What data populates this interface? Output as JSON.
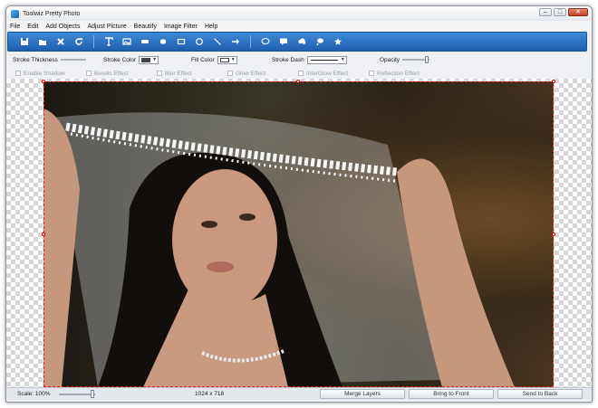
{
  "window": {
    "title": "Toolwiz Pretty Photo"
  },
  "menu": [
    "File",
    "Edit",
    "Add Objects",
    "Adjust Picture",
    "Beautify",
    "Image Filter",
    "Help"
  ],
  "toolbar": {
    "groups": [
      [
        "save-icon",
        "open-folder-icon",
        "delete-icon",
        "refresh-icon"
      ],
      [
        "text-icon",
        "image-icon",
        "rounded-rectangle-icon",
        "rounded-square-icon",
        "rectangle-icon",
        "circle-icon",
        "line-icon",
        "arrow-icon"
      ],
      [
        "speech-bubble-icon",
        "square-bubble-icon",
        "cloud-icon",
        "thought-bubble-icon",
        "star-icon"
      ]
    ]
  },
  "properties": {
    "stroke_thickness": "Stroke Thickness",
    "stroke_color": "Stroke Color",
    "stroke_color_value": "#444444",
    "fill_color": "Fill Color",
    "fill_color_value": "#ffffff",
    "stroke_dash": "Stroke Dash",
    "opacity": "Opacity",
    "opacity_value": 100
  },
  "effects": [
    "Enable Shadow",
    "Bevels Effect",
    "Blur Effect",
    "Glow Effect",
    "InterGlow Effect",
    "Reflection Effect"
  ],
  "status": {
    "scale": "Scale: 100%",
    "dimensions": "1024 x 718",
    "merge_layers": "Merge Layers",
    "bring_to_front": "Bring to Front",
    "send_to_back": "Send to Back"
  },
  "colors": {
    "toolbar_blue": "#2a6fc0",
    "selection_red": "#dd2222"
  }
}
